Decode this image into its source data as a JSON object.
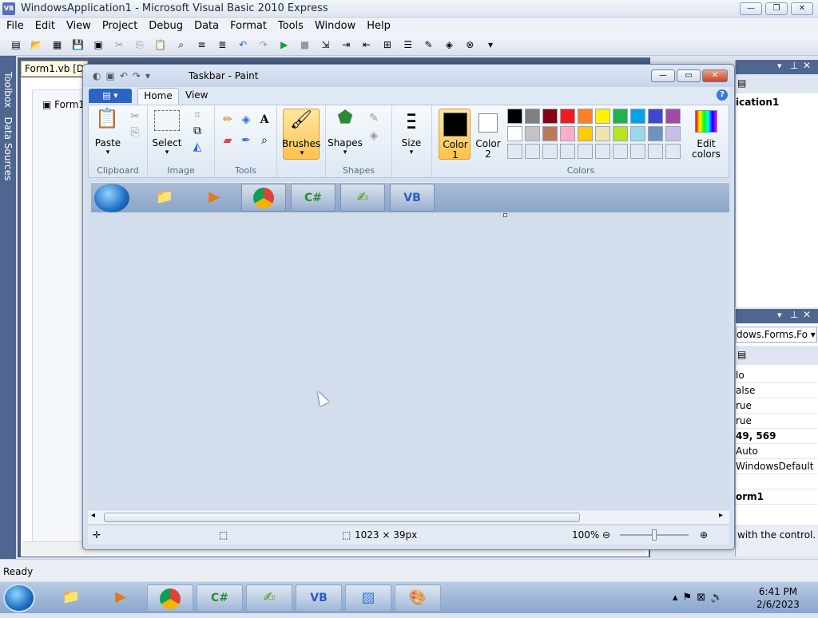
{
  "vs": {
    "title": "WindowsApplication1 - Microsoft Visual Basic 2010 Express",
    "logo": "VB",
    "menu": [
      "File",
      "Edit",
      "View",
      "Project",
      "Debug",
      "Data",
      "Format",
      "Tools",
      "Window",
      "Help"
    ],
    "toolbox_label": "Toolbox",
    "datasources_label": "Data Sources",
    "doc_tab": "Form1.vb [De",
    "designer_form": "Form1",
    "solution_text": "ication1",
    "props_combo": "dows.Forms.Fo",
    "props_rows": [
      "lo",
      "alse",
      "rue",
      "rue",
      "49, 569",
      "Auto",
      "WindowsDefault",
      "",
      "orm1"
    ],
    "props_desc": "with the control.",
    "status": "Ready"
  },
  "paint": {
    "title": "Taskbar - Paint",
    "tabs": {
      "home": "Home",
      "view": "View"
    },
    "groups": {
      "clipboard": "Clipboard",
      "image": "Image",
      "tools": "Tools",
      "shapes": "Shapes",
      "colors": "Colors"
    },
    "buttons": {
      "paste": "Paste",
      "select": "Select",
      "brushes": "Brushes",
      "shapes": "Shapes",
      "size": "Size",
      "color1": "Color\n1",
      "color2": "Color\n2",
      "edit_colors": "Edit\ncolors"
    },
    "palette_row1": [
      "#000000",
      "#7f7f7f",
      "#880015",
      "#ed1c24",
      "#ff7f27",
      "#fff200",
      "#22b14c",
      "#00a2e8",
      "#3f48cc",
      "#a349a4"
    ],
    "palette_row2": [
      "#ffffff",
      "#c3c3c3",
      "#b97a57",
      "#ffaec9",
      "#ffc90e",
      "#efe4b0",
      "#b5e61d",
      "#99d9ea",
      "#7092be",
      "#c8bfe7"
    ],
    "status_size": "1023 × 39px",
    "zoom": "100%"
  },
  "taskbar": {
    "time": "6:41 PM",
    "date": "2/6/2023"
  }
}
